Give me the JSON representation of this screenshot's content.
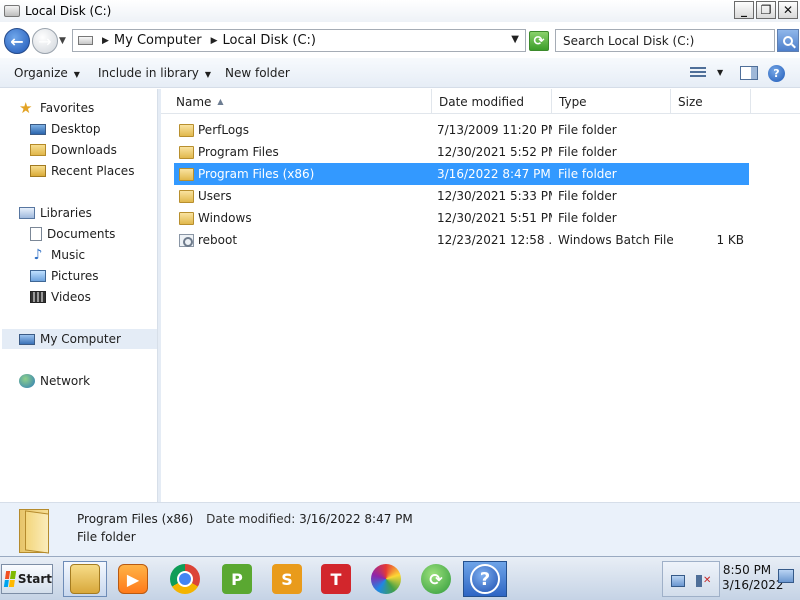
{
  "window": {
    "title": "Local Disk (C:)"
  },
  "address": {
    "crumbs": [
      "My Computer",
      "Local Disk (C:)"
    ],
    "search_placeholder": "Search Local Disk (C:)"
  },
  "toolbar": {
    "organize": "Organize",
    "include_in_library": "Include in library",
    "new_folder": "New folder"
  },
  "nav": {
    "favorites": {
      "label": "Favorites",
      "items": [
        "Desktop",
        "Downloads",
        "Recent Places"
      ]
    },
    "libraries": {
      "label": "Libraries",
      "items": [
        "Documents",
        "Music",
        "Pictures",
        "Videos"
      ]
    },
    "computer": "My Computer",
    "network": "Network",
    "selected": "My Computer"
  },
  "columns": {
    "name": "Name",
    "date": "Date modified",
    "type": "Type",
    "size": "Size"
  },
  "files": [
    {
      "name": "PerfLogs",
      "date": "7/13/2009 11:20 PM",
      "type": "File folder",
      "size": "",
      "icon": "folder-icon"
    },
    {
      "name": "Program Files",
      "date": "12/30/2021 5:52 PM",
      "type": "File folder",
      "size": "",
      "icon": "folder-icon"
    },
    {
      "name": "Program Files (x86)",
      "date": "3/16/2022 8:47 PM",
      "type": "File folder",
      "size": "",
      "icon": "folder-icon",
      "selected": true
    },
    {
      "name": "Users",
      "date": "12/30/2021 5:33 PM",
      "type": "File folder",
      "size": "",
      "icon": "folder-icon"
    },
    {
      "name": "Windows",
      "date": "12/30/2021 5:51 PM",
      "type": "File folder",
      "size": "",
      "icon": "folder-icon"
    },
    {
      "name": "reboot",
      "date": "12/23/2021 12:58 ...",
      "type": "Windows Batch File",
      "size": "1 KB",
      "icon": "batch-file-icon"
    }
  ],
  "details": {
    "name": "Program Files (x86)",
    "date_label": "Date modified:",
    "date": "3/16/2022 8:47 PM",
    "type": "File folder"
  },
  "taskbar": {
    "start": "Start",
    "time": "8:50 PM",
    "date": "3/16/2022",
    "apps": [
      "file-explorer-icon",
      "media-player-icon",
      "chrome-icon",
      "p-app-icon",
      "s-app-icon",
      "t-app-icon",
      "photos-icon",
      "sync-icon",
      "help-icon"
    ]
  },
  "colors": {
    "selection": "#3399ff",
    "nav_selected": "#e4ecf6",
    "details_bg": "#eaf1fa"
  }
}
